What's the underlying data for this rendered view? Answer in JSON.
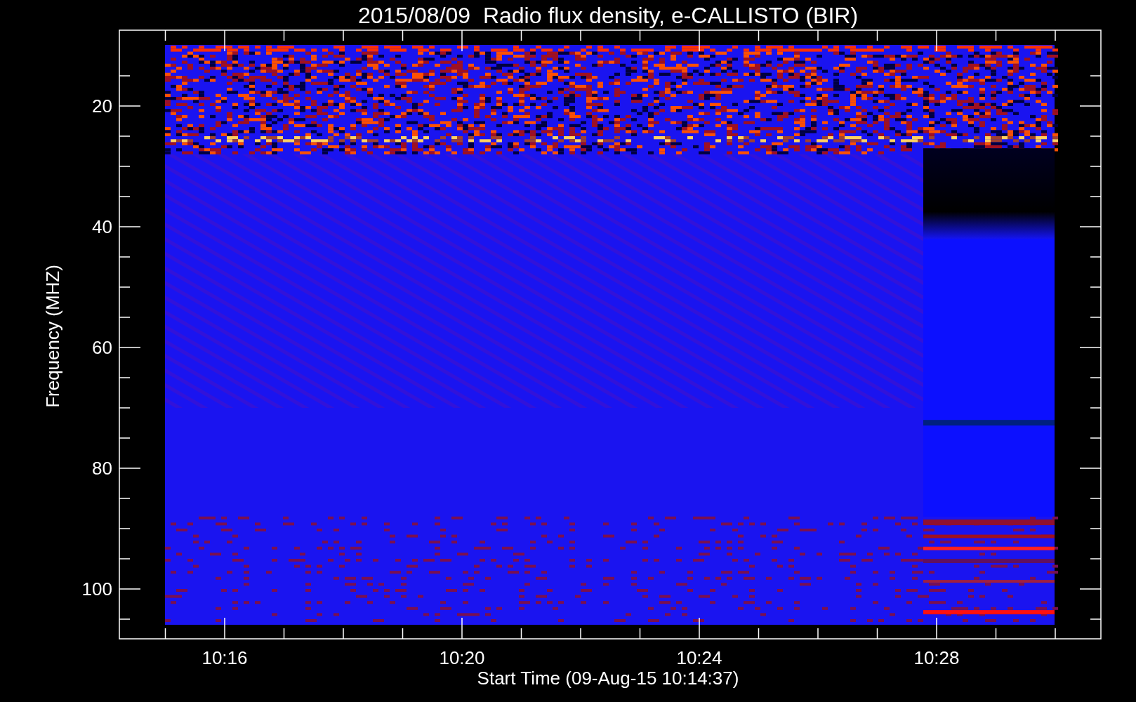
{
  "title": "2015/08/09  Radio flux density, e-CALLISTO (BIR)",
  "y_axis": {
    "label": "Frequency (MHZ)",
    "ticks": [
      "20",
      "40",
      "60",
      "80",
      "100"
    ]
  },
  "x_axis": {
    "label": "Start Time (09-Aug-15 10:14:37)",
    "ticks": [
      "10:16",
      "10:20",
      "10:24",
      "10:28"
    ]
  }
}
